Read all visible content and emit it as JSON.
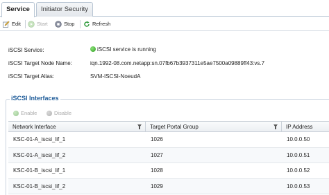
{
  "tabs": [
    {
      "label": "Service",
      "active": true
    },
    {
      "label": "Initiator Security",
      "active": false
    }
  ],
  "toolbar": {
    "edit": "Edit",
    "start": "Start",
    "stop": "Stop",
    "refresh": "Refresh"
  },
  "fields": {
    "service_label": "iSCSI Service:",
    "service_value": "iSCSI service is running",
    "node_label": "iSCSI Target Node Name:",
    "node_value": "iqn.1992-08.com.netapp:sn.07fb67b3937311e5ae7500a09889ff43:vs.7",
    "alias_label": "iSCSI Target Alias:",
    "alias_value": "SVM-ISCSI-NoeudA"
  },
  "interfaces": {
    "title": "iSCSI Interfaces",
    "enable": "Enable",
    "disable": "Disable",
    "columns": [
      "Network Interface",
      "Target Portal Group",
      "IP Address"
    ],
    "rows": [
      [
        "KSC-01-A_iscsi_lif_1",
        "1026",
        "10.0.0.50"
      ],
      [
        "KSC-01-A_iscsi_lif_2",
        "1027",
        "10.0.0.51"
      ],
      [
        "KSC-01-B_iscsi_lif_1",
        "1028",
        "10.0.0.52"
      ],
      [
        "KSC-01-B_iscsi_lif_2",
        "1029",
        "10.0.0.53"
      ]
    ]
  },
  "colors": {
    "accent": "#1f5c99",
    "status_running": "#2e9e22"
  }
}
